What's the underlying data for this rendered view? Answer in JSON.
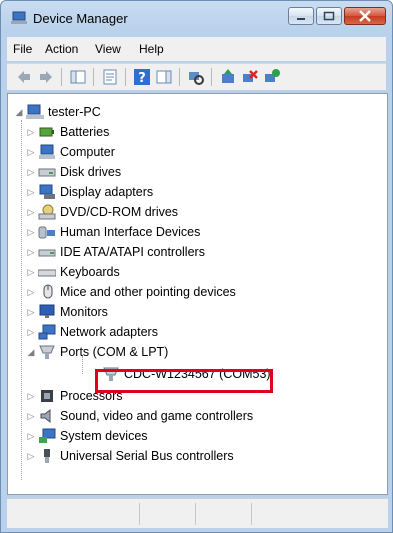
{
  "window": {
    "title": "Device Manager"
  },
  "menu": {
    "file": "File",
    "action": "Action",
    "view": "View",
    "help": "Help"
  },
  "tree": {
    "root": "tester-PC",
    "items": [
      {
        "label": "Batteries",
        "icon": "battery-icon",
        "expanded": false
      },
      {
        "label": "Computer",
        "icon": "computer-icon",
        "expanded": false
      },
      {
        "label": "Disk drives",
        "icon": "disk-drive-icon",
        "expanded": false
      },
      {
        "label": "Display adapters",
        "icon": "display-adapter-icon",
        "expanded": false
      },
      {
        "label": "DVD/CD-ROM drives",
        "icon": "dvd-drive-icon",
        "expanded": false
      },
      {
        "label": "Human Interface Devices",
        "icon": "hid-icon",
        "expanded": false
      },
      {
        "label": "IDE ATA/ATAPI controllers",
        "icon": "ide-controller-icon",
        "expanded": false
      },
      {
        "label": "Keyboards",
        "icon": "keyboard-icon",
        "expanded": false
      },
      {
        "label": "Mice and other pointing devices",
        "icon": "mouse-icon",
        "expanded": false
      },
      {
        "label": "Monitors",
        "icon": "monitor-icon",
        "expanded": false
      },
      {
        "label": "Network adapters",
        "icon": "network-adapter-icon",
        "expanded": false
      },
      {
        "label": "Ports (COM & LPT)",
        "icon": "port-icon",
        "expanded": true,
        "children": [
          {
            "label": "CDC-W1234567 (COM53)",
            "icon": "port-icon",
            "highlighted": true
          }
        ]
      },
      {
        "label": "Processors",
        "icon": "processor-icon",
        "expanded": false
      },
      {
        "label": "Sound, video and game controllers",
        "icon": "sound-icon",
        "expanded": false
      },
      {
        "label": "System devices",
        "icon": "system-device-icon",
        "expanded": false
      },
      {
        "label": "Universal Serial Bus controllers",
        "icon": "usb-icon",
        "expanded": false
      }
    ]
  },
  "colors": {
    "highlight_border": "#e0001b",
    "title_bar": "#b9d1ea"
  }
}
